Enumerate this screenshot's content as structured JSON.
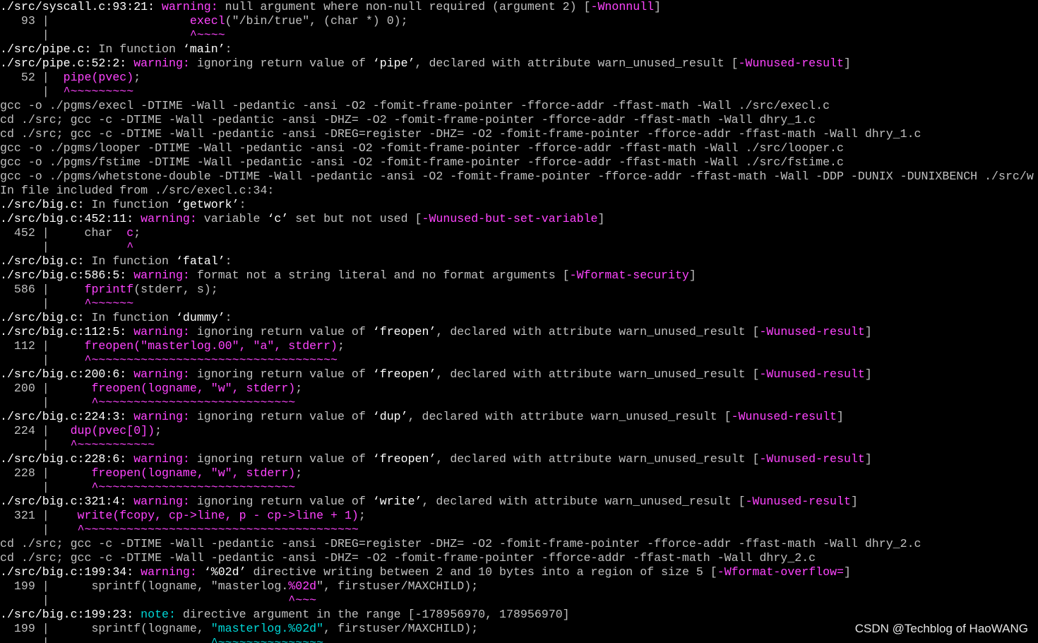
{
  "terminal": {
    "lines": [
      [
        {
          "t": "./src/syscall.c:93:21: ",
          "c": "p"
        },
        {
          "t": "warning:",
          "c": "w"
        },
        {
          "t": " null argument where non-null required (argument 2) [",
          "c": "d"
        },
        {
          "t": "-Wnonnull",
          "c": "w"
        },
        {
          "t": "]",
          "c": "d"
        }
      ],
      [
        {
          "t": "   93 |                    ",
          "c": "d"
        },
        {
          "t": "execl",
          "c": "w"
        },
        {
          "t": "(\"/bin/true\", (char *) 0);",
          "c": "d"
        }
      ],
      [
        {
          "t": "      |                    ",
          "c": "d"
        },
        {
          "t": "^~~~~",
          "c": "w"
        }
      ],
      [
        {
          "t": "./src/pipe.c:",
          "c": "p"
        },
        {
          "t": " In function ",
          "c": "d"
        },
        {
          "t": "‘main’",
          "c": "p"
        },
        {
          "t": ":",
          "c": "d"
        }
      ],
      [
        {
          "t": "./src/pipe.c:52:2: ",
          "c": "p"
        },
        {
          "t": "warning:",
          "c": "w"
        },
        {
          "t": " ignoring return value of ",
          "c": "d"
        },
        {
          "t": "‘pipe’",
          "c": "p"
        },
        {
          "t": ", declared with attribute warn_unused_result [",
          "c": "d"
        },
        {
          "t": "-Wunused-result",
          "c": "w"
        },
        {
          "t": "]",
          "c": "d"
        }
      ],
      [
        {
          "t": "   52 |  ",
          "c": "d"
        },
        {
          "t": "pipe(pvec)",
          "c": "w"
        },
        {
          "t": ";",
          "c": "d"
        }
      ],
      [
        {
          "t": "      |  ",
          "c": "d"
        },
        {
          "t": "^~~~~~~~~~",
          "c": "w"
        }
      ],
      [
        {
          "t": "gcc -o ./pgms/execl -DTIME -Wall -pedantic -ansi -O2 -fomit-frame-pointer -fforce-addr -ffast-math -Wall ./src/execl.c",
          "c": "d"
        }
      ],
      [
        {
          "t": "cd ./src; gcc -c -DTIME -Wall -pedantic -ansi -DHZ= -O2 -fomit-frame-pointer -fforce-addr -ffast-math -Wall dhry_1.c",
          "c": "d"
        }
      ],
      [
        {
          "t": "cd ./src; gcc -c -DTIME -Wall -pedantic -ansi -DREG=register -DHZ= -O2 -fomit-frame-pointer -fforce-addr -ffast-math -Wall dhry_1.c",
          "c": "d"
        }
      ],
      [
        {
          "t": "gcc -o ./pgms/looper -DTIME -Wall -pedantic -ansi -O2 -fomit-frame-pointer -fforce-addr -ffast-math -Wall ./src/looper.c",
          "c": "d"
        }
      ],
      [
        {
          "t": "gcc -o ./pgms/fstime -DTIME -Wall -pedantic -ansi -O2 -fomit-frame-pointer -fforce-addr -ffast-math -Wall ./src/fstime.c",
          "c": "d"
        }
      ],
      [
        {
          "t": "gcc -o ./pgms/whetstone-double -DTIME -Wall -pedantic -ansi -O2 -fomit-frame-pointer -fforce-addr -ffast-math -Wall -DDP -DUNIX -DUNIXBENCH ./src/w",
          "c": "d"
        }
      ],
      [
        {
          "t": "In file included from ./src/execl.c:34:",
          "c": "d"
        }
      ],
      [
        {
          "t": "./src/big.c:",
          "c": "p"
        },
        {
          "t": " In function ",
          "c": "d"
        },
        {
          "t": "‘getwork’",
          "c": "p"
        },
        {
          "t": ":",
          "c": "d"
        }
      ],
      [
        {
          "t": "./src/big.c:452:11: ",
          "c": "p"
        },
        {
          "t": "warning:",
          "c": "w"
        },
        {
          "t": " variable ",
          "c": "d"
        },
        {
          "t": "‘c’",
          "c": "p"
        },
        {
          "t": " set but not used [",
          "c": "d"
        },
        {
          "t": "-Wunused-but-set-variable",
          "c": "w"
        },
        {
          "t": "]",
          "c": "d"
        }
      ],
      [
        {
          "t": "  452 |     char  ",
          "c": "d"
        },
        {
          "t": "c",
          "c": "w"
        },
        {
          "t": ";",
          "c": "d"
        }
      ],
      [
        {
          "t": "      |           ",
          "c": "d"
        },
        {
          "t": "^",
          "c": "w"
        }
      ],
      [
        {
          "t": "./src/big.c:",
          "c": "p"
        },
        {
          "t": " In function ",
          "c": "d"
        },
        {
          "t": "‘fatal’",
          "c": "p"
        },
        {
          "t": ":",
          "c": "d"
        }
      ],
      [
        {
          "t": "./src/big.c:586:5: ",
          "c": "p"
        },
        {
          "t": "warning:",
          "c": "w"
        },
        {
          "t": " format not a string literal and no format arguments [",
          "c": "d"
        },
        {
          "t": "-Wformat-security",
          "c": "w"
        },
        {
          "t": "]",
          "c": "d"
        }
      ],
      [
        {
          "t": "  586 |     ",
          "c": "d"
        },
        {
          "t": "fprintf",
          "c": "w"
        },
        {
          "t": "(stderr, s);",
          "c": "d"
        }
      ],
      [
        {
          "t": "      |     ",
          "c": "d"
        },
        {
          "t": "^~~~~~~",
          "c": "w"
        }
      ],
      [
        {
          "t": "./src/big.c:",
          "c": "p"
        },
        {
          "t": " In function ",
          "c": "d"
        },
        {
          "t": "‘dummy’",
          "c": "p"
        },
        {
          "t": ":",
          "c": "d"
        }
      ],
      [
        {
          "t": "./src/big.c:112:5: ",
          "c": "p"
        },
        {
          "t": "warning:",
          "c": "w"
        },
        {
          "t": " ignoring return value of ",
          "c": "d"
        },
        {
          "t": "‘freopen’",
          "c": "p"
        },
        {
          "t": ", declared with attribute warn_unused_result [",
          "c": "d"
        },
        {
          "t": "-Wunused-result",
          "c": "w"
        },
        {
          "t": "]",
          "c": "d"
        }
      ],
      [
        {
          "t": "  112 |     ",
          "c": "d"
        },
        {
          "t": "freopen(\"masterlog.00\", \"a\", stderr)",
          "c": "w"
        },
        {
          "t": ";",
          "c": "d"
        }
      ],
      [
        {
          "t": "      |     ",
          "c": "d"
        },
        {
          "t": "^~~~~~~~~~~~~~~~~~~~~~~~~~~~~~~~~~~~",
          "c": "w"
        }
      ],
      [
        {
          "t": "./src/big.c:200:6: ",
          "c": "p"
        },
        {
          "t": "warning:",
          "c": "w"
        },
        {
          "t": " ignoring return value of ",
          "c": "d"
        },
        {
          "t": "‘freopen’",
          "c": "p"
        },
        {
          "t": ", declared with attribute warn_unused_result [",
          "c": "d"
        },
        {
          "t": "-Wunused-result",
          "c": "w"
        },
        {
          "t": "]",
          "c": "d"
        }
      ],
      [
        {
          "t": "  200 |      ",
          "c": "d"
        },
        {
          "t": "freopen(logname, \"w\", stderr)",
          "c": "w"
        },
        {
          "t": ";",
          "c": "d"
        }
      ],
      [
        {
          "t": "      |      ",
          "c": "d"
        },
        {
          "t": "^~~~~~~~~~~~~~~~~~~~~~~~~~~~~",
          "c": "w"
        }
      ],
      [
        {
          "t": "./src/big.c:224:3: ",
          "c": "p"
        },
        {
          "t": "warning:",
          "c": "w"
        },
        {
          "t": " ignoring return value of ",
          "c": "d"
        },
        {
          "t": "‘dup’",
          "c": "p"
        },
        {
          "t": ", declared with attribute warn_unused_result [",
          "c": "d"
        },
        {
          "t": "-Wunused-result",
          "c": "w"
        },
        {
          "t": "]",
          "c": "d"
        }
      ],
      [
        {
          "t": "  224 |   ",
          "c": "d"
        },
        {
          "t": "dup(pvec[0])",
          "c": "w"
        },
        {
          "t": ";",
          "c": "d"
        }
      ],
      [
        {
          "t": "      |   ",
          "c": "d"
        },
        {
          "t": "^~~~~~~~~~~~",
          "c": "w"
        }
      ],
      [
        {
          "t": "./src/big.c:228:6: ",
          "c": "p"
        },
        {
          "t": "warning:",
          "c": "w"
        },
        {
          "t": " ignoring return value of ",
          "c": "d"
        },
        {
          "t": "‘freopen’",
          "c": "p"
        },
        {
          "t": ", declared with attribute warn_unused_result [",
          "c": "d"
        },
        {
          "t": "-Wunused-result",
          "c": "w"
        },
        {
          "t": "]",
          "c": "d"
        }
      ],
      [
        {
          "t": "  228 |      ",
          "c": "d"
        },
        {
          "t": "freopen(logname, \"w\", stderr)",
          "c": "w"
        },
        {
          "t": ";",
          "c": "d"
        }
      ],
      [
        {
          "t": "      |      ",
          "c": "d"
        },
        {
          "t": "^~~~~~~~~~~~~~~~~~~~~~~~~~~~~",
          "c": "w"
        }
      ],
      [
        {
          "t": "./src/big.c:321:4: ",
          "c": "p"
        },
        {
          "t": "warning:",
          "c": "w"
        },
        {
          "t": " ignoring return value of ",
          "c": "d"
        },
        {
          "t": "‘write’",
          "c": "p"
        },
        {
          "t": ", declared with attribute warn_unused_result [",
          "c": "d"
        },
        {
          "t": "-Wunused-result",
          "c": "w"
        },
        {
          "t": "]",
          "c": "d"
        }
      ],
      [
        {
          "t": "  321 |    ",
          "c": "d"
        },
        {
          "t": "write(fcopy, cp->line, p - cp->line + 1)",
          "c": "w"
        },
        {
          "t": ";",
          "c": "d"
        }
      ],
      [
        {
          "t": "      |    ",
          "c": "d"
        },
        {
          "t": "^~~~~~~~~~~~~~~~~~~~~~~~~~~~~~~~~~~~~~~~",
          "c": "w"
        }
      ],
      [
        {
          "t": "cd ./src; gcc -c -DTIME -Wall -pedantic -ansi -DREG=register -DHZ= -O2 -fomit-frame-pointer -fforce-addr -ffast-math -Wall dhry_2.c",
          "c": "d"
        }
      ],
      [
        {
          "t": "cd ./src; gcc -c -DTIME -Wall -pedantic -ansi -DHZ= -O2 -fomit-frame-pointer -fforce-addr -ffast-math -Wall dhry_2.c",
          "c": "d"
        }
      ],
      [
        {
          "t": "./src/big.c:199:34: ",
          "c": "p"
        },
        {
          "t": "warning:",
          "c": "w"
        },
        {
          "t": " ",
          "c": "d"
        },
        {
          "t": "‘%02d’",
          "c": "p"
        },
        {
          "t": " directive writing between 2 and 10 bytes into a region of size 5 [",
          "c": "d"
        },
        {
          "t": "-Wformat-overflow=",
          "c": "w"
        },
        {
          "t": "]",
          "c": "d"
        }
      ],
      [
        {
          "t": "  199 |      sprintf(logname, \"masterlog.",
          "c": "d"
        },
        {
          "t": "%02d",
          "c": "w"
        },
        {
          "t": "\", firstuser/MAXCHILD);",
          "c": "d"
        }
      ],
      [
        {
          "t": "      |                                  ",
          "c": "d"
        },
        {
          "t": "^~~~",
          "c": "w"
        }
      ],
      [
        {
          "t": "./src/big.c:199:23: ",
          "c": "p"
        },
        {
          "t": "note:",
          "c": "n"
        },
        {
          "t": " directive argument in the range [-178956970, 178956970]",
          "c": "d"
        }
      ],
      [
        {
          "t": "  199 |      sprintf(logname, ",
          "c": "d"
        },
        {
          "t": "\"masterlog.%02d\"",
          "c": "n"
        },
        {
          "t": ", firstuser/MAXCHILD);",
          "c": "d"
        }
      ],
      [
        {
          "t": "      |                       ",
          "c": "d"
        },
        {
          "t": "^~~~~~~~~~~~~~~~",
          "c": "n"
        }
      ]
    ]
  },
  "watermark": {
    "text": "CSDN @Techblog of HaoWANG"
  },
  "colors": {
    "background": "#000000",
    "text": "#c0c0c0",
    "warning": "#ff44ff",
    "note": "#00d7d7",
    "path": "#ffffff"
  }
}
